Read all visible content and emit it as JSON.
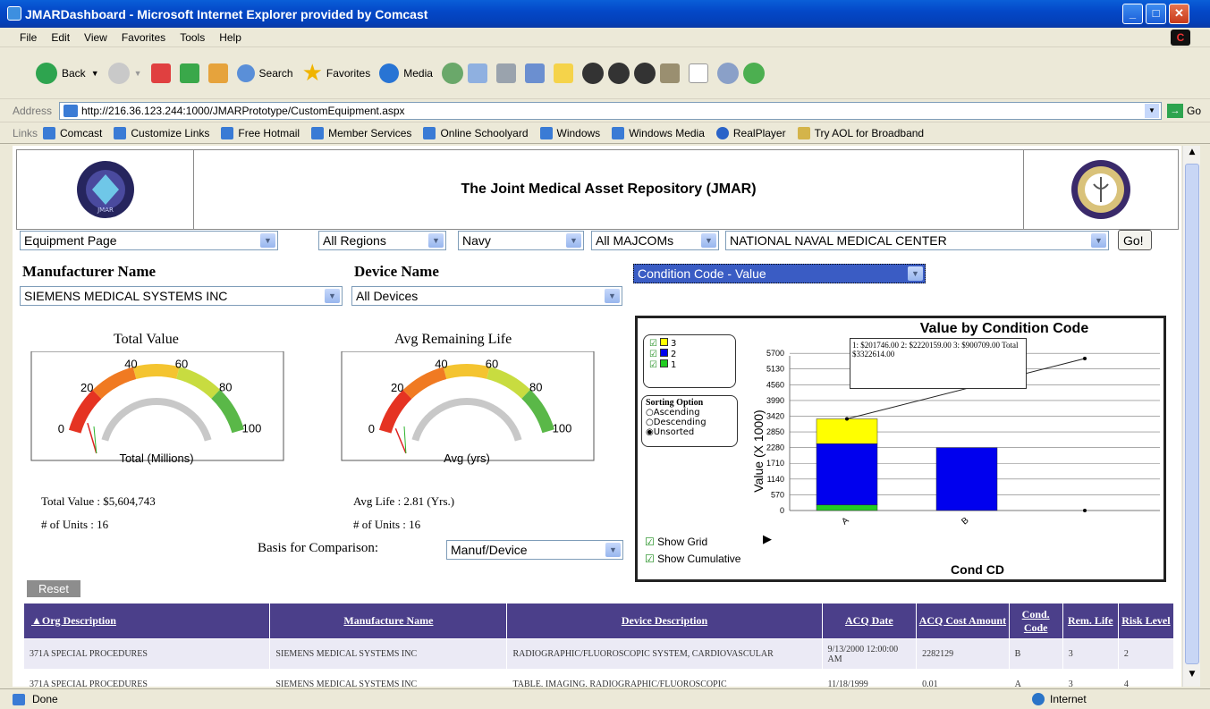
{
  "window": {
    "title": "JMARDashboard - Microsoft Internet Explorer provided by Comcast"
  },
  "menu": [
    "File",
    "Edit",
    "View",
    "Favorites",
    "Tools",
    "Help"
  ],
  "toolbar": {
    "back": "Back",
    "search": "Search",
    "favorites": "Favorites",
    "media": "Media"
  },
  "address": {
    "label": "Address",
    "url": "http://216.36.123.244:1000/JMARPrototype/CustomEquipment.aspx",
    "go": "Go"
  },
  "links": {
    "label": "Links",
    "items": [
      "Comcast",
      "Customize Links",
      "Free Hotmail",
      "Member Services",
      "Online Schoolyard",
      "Windows",
      "Windows Media",
      "RealPlayer",
      "Try AOL for Broadband"
    ]
  },
  "page": {
    "title": "The Joint Medical Asset Repository (JMAR)",
    "logo_left_text": "JMAR"
  },
  "filters": {
    "page": "Equipment Page",
    "region": "All Regions",
    "service": "Navy",
    "majcom": "All MAJCOMs",
    "facility": "NATIONAL NAVAL MEDICAL CENTER",
    "go": "Go!"
  },
  "labels": {
    "manufacturer": "Manufacturer Name",
    "device": "Device Name"
  },
  "selects": {
    "manufacturer": "SIEMENS MEDICAL SYSTEMS INC",
    "device": "All Devices",
    "chart_metric": "Condition Code - Value",
    "basis": "Manuf/Device"
  },
  "gauge1": {
    "title": "Total Value",
    "unit": "Total (Millions)",
    "ticks": [
      "0",
      "20",
      "40",
      "60",
      "80",
      "100"
    ],
    "stat1": "Total Value : $5,604,743",
    "stat2": "# of Units : 16",
    "level": 6
  },
  "gauge2": {
    "title": "Avg Remaining Life",
    "unit": "Avg (yrs)",
    "ticks": [
      "0",
      "20",
      "40",
      "60",
      "80",
      "100"
    ],
    "stat1": "Avg Life : 2.81 (Yrs.)",
    "stat2": "# of Units : 16",
    "level": 3
  },
  "basis_label": "Basis for Comparison:",
  "chart": {
    "legend": [
      "3",
      "2",
      "1"
    ],
    "sorting_title": "Sorting Option",
    "sorting": [
      "Ascending",
      "Descending",
      "Unsorted"
    ],
    "tooltip": "1: $201746.00 2: $2220159.00 3: $900709.00  Total $3322614.00",
    "show_grid": "Show Grid",
    "show_cumulative": "Show Cumulative"
  },
  "chart_data": {
    "type": "bar",
    "title": "Value by Condition Code",
    "xlabel": "Cond CD",
    "ylabel": "Value (X 1000)",
    "categories": [
      "A",
      "B"
    ],
    "series": [
      {
        "name": "1",
        "values": [
          201.746,
          0
        ],
        "color": "#22cc22"
      },
      {
        "name": "2",
        "values": [
          2220.159,
          2282.129
        ],
        "color": "#0000ee"
      },
      {
        "name": "3",
        "values": [
          900.709,
          0
        ],
        "color": "#ffff00"
      }
    ],
    "yticks": [
      "0",
      "570",
      "1140",
      "1710",
      "2280",
      "2850",
      "3420",
      "3990",
      "4560",
      "5130",
      "5700"
    ],
    "ylim": [
      0,
      6000
    ],
    "grid": true
  },
  "reset": "Reset",
  "table": {
    "headers": [
      "Org Description",
      "Manufacture Name",
      "Device Description",
      "ACQ Date",
      "ACQ Cost Amount",
      "Cond. Code",
      "Rem. Life",
      "Risk Level"
    ],
    "rows": [
      [
        "371A SPECIAL PROCEDURES",
        "SIEMENS MEDICAL SYSTEMS INC",
        "RADIOGRAPHIC/FLUOROSCOPIC SYSTEM, CARDIOVASCULAR",
        "9/13/2000 12:00:00 AM",
        "2282129",
        "B",
        "3",
        "2"
      ],
      [
        "371A SPECIAL PROCEDURES",
        "SIEMENS MEDICAL SYSTEMS INC",
        "TABLE, IMAGING, RADIOGRAPHIC/FLUOROSCOPIC",
        "11/18/1999",
        "0.01",
        "A",
        "3",
        "4"
      ]
    ]
  },
  "status": {
    "left": "Done",
    "zone": "Internet"
  }
}
